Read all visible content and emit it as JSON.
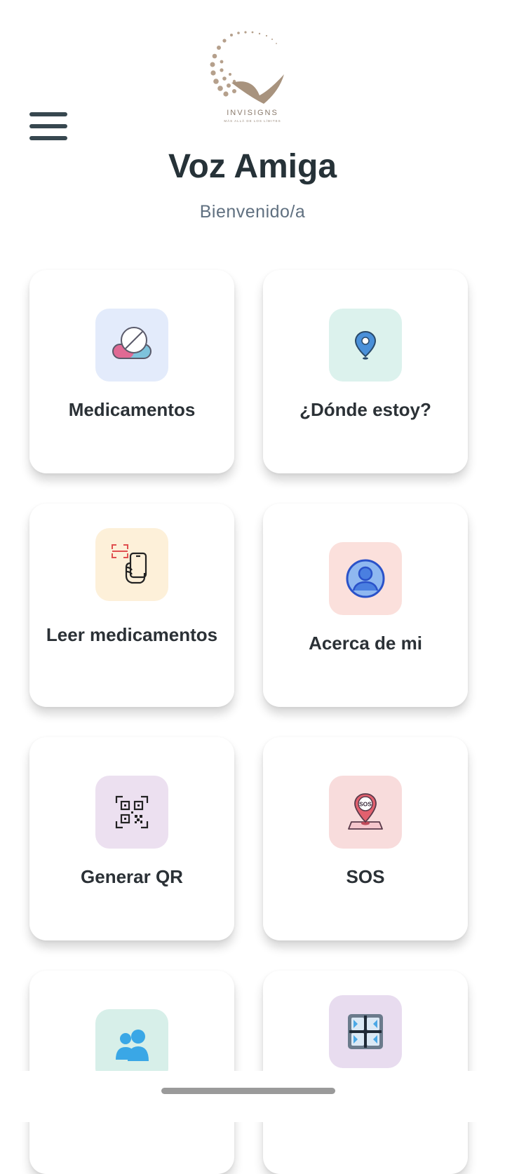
{
  "app": {
    "title": "Voz Amiga",
    "subtitle": "Bienvenido/a",
    "logo_text": "INVISIGNS",
    "logo_tagline": "MÁS ALLÁ DE LOS LÍMITES"
  },
  "cards": [
    {
      "label": "Medicamentos",
      "icon": "pill-icon",
      "tile_color": "#e3ebfb"
    },
    {
      "label": "¿Dónde estoy?",
      "icon": "location-pin-icon",
      "tile_color": "#dcf2ed"
    },
    {
      "label": "Leer medicamentos",
      "icon": "phone-scan-icon",
      "tile_color": "#fdf0d9"
    },
    {
      "label": "Acerca de mi",
      "icon": "user-profile-icon",
      "tile_color": "#fbe0dc"
    },
    {
      "label": "Generar QR",
      "icon": "qr-code-icon",
      "tile_color": "#ece0f0"
    },
    {
      "label": "SOS",
      "icon": "sos-pin-icon",
      "tile_color": "#f8dcdc"
    },
    {
      "label": "",
      "icon": "people-icon",
      "tile_color": "#d7efe9"
    },
    {
      "label": "",
      "icon": "grid-icon",
      "tile_color": "#e8dcef"
    }
  ]
}
